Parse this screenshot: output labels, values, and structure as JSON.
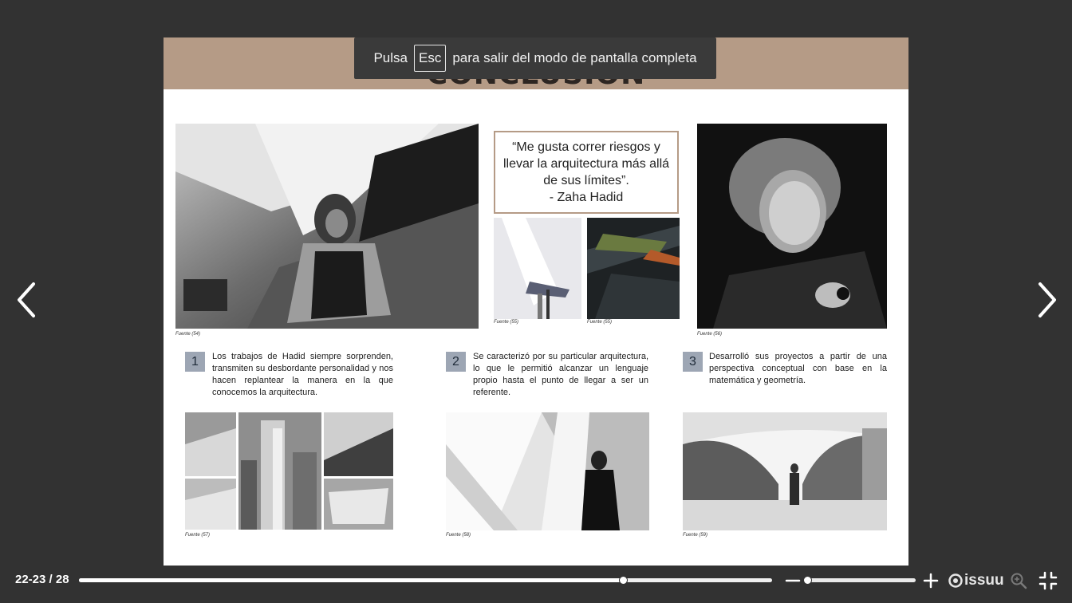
{
  "spread": {
    "heading": "CONCLUSIÓN",
    "quote": {
      "lines": [
        "“Me gusta correr riesgos y",
        "llevar la arquitectura más allá",
        "de sus límites”.",
        "- Zaha Hadid"
      ]
    },
    "credits": {
      "c54": "Fuente (54)",
      "c55a": "Fuente (55)",
      "c55b": "Fuente (55)",
      "c56": "Fuente (56)",
      "c57": "Fuente (57)",
      "c58": "Fuente (58)",
      "c59": "Fuente (59)"
    },
    "points": [
      {
        "num": "1",
        "text": "Los trabajos de Hadid siempre sorprenden, transmiten su desbordante personalidad y nos hacen replantear la manera en la que conocemos la arquitectura."
      },
      {
        "num": "2",
        "text": "Se caracterizó por su particular arquitectura, lo que le permitió alcanzar un lenguaje propio hasta el punto de llegar a ser un referente."
      },
      {
        "num": "3",
        "text": "Desarrolló sus proyectos a partir de una perspectiva conceptual con base en la matemática y geometría."
      }
    ]
  },
  "toast": {
    "prefix": "Pulsa",
    "key": "Esc",
    "suffix": "para salir del modo de pantalla completa"
  },
  "nav": {
    "prev_icon": "chevron-left-icon",
    "next_icon": "chevron-right-icon"
  },
  "footer": {
    "page_info": "22-23 / 28",
    "progress": 0.785,
    "zoom_level": 0.0,
    "logo_text": "issuu",
    "icons": [
      "zoom-out-icon",
      "zoom-in-icon",
      "issuu-logo-icon",
      "magnifier-icon",
      "exit-fullscreen-icon"
    ]
  },
  "colors": {
    "background": "#323232",
    "band": "#b59b86",
    "number_badge": "#9da6b4"
  }
}
